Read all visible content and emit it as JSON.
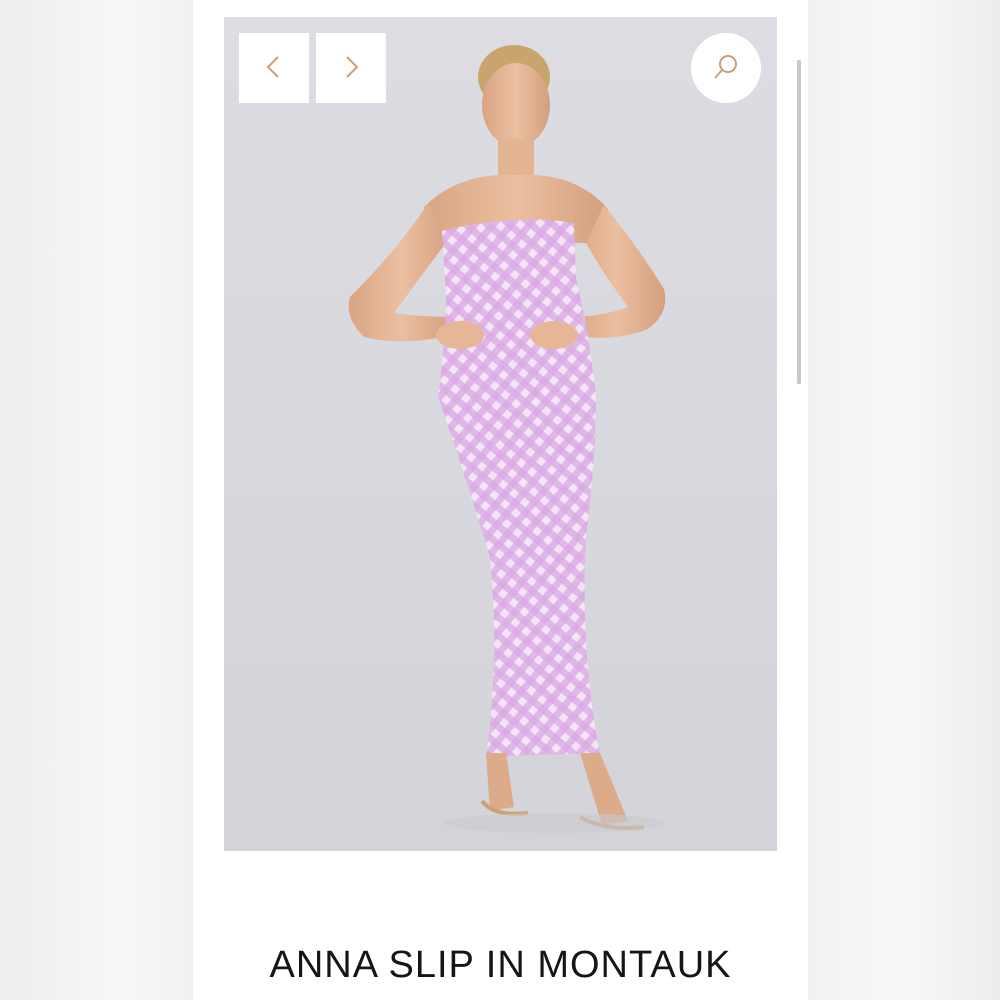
{
  "product": {
    "title": "ANNA SLIP IN MONTAUK",
    "image_alt": "Model wearing the Anna Slip dress in a lilac gingham print"
  },
  "gallery": {
    "prev_icon": "chevron-left-icon",
    "next_icon": "chevron-right-icon",
    "zoom_icon": "search-icon"
  },
  "colors": {
    "accent": "#c8a07a",
    "dress": "#d4a3dd",
    "image_background": "#d8d9de"
  }
}
